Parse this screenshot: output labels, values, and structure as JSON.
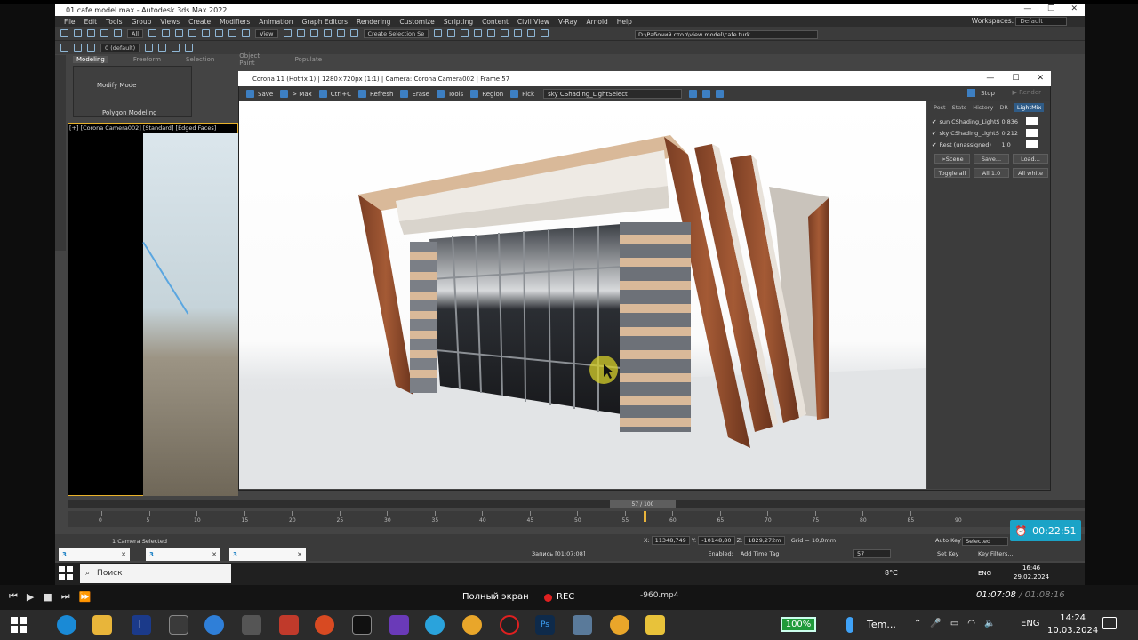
{
  "app": {
    "title": "01 cafe model.max - Autodesk 3ds Max 2022",
    "menu": [
      "File",
      "Edit",
      "Tools",
      "Group",
      "Views",
      "Create",
      "Modifiers",
      "Animation",
      "Graph Editors",
      "Rendering",
      "Customize",
      "Scripting",
      "Content",
      "Civil View",
      "V-Ray",
      "Arnold",
      "Help"
    ],
    "workspace_label": "Workspaces:",
    "workspace_value": "Default",
    "selection_filter": "All",
    "view_dropdown": "View",
    "selection_set": "Create Selection Se",
    "layer": "0 (default)",
    "path": "D:\\Рабочий стол\\view model\\cafe turk"
  },
  "ribbon": {
    "tabs": [
      "Modeling",
      "Freeform",
      "Selection",
      "Object Paint",
      "Populate"
    ],
    "modify_mode": "Modify Mode",
    "polygon_modeling": "Polygon Modeling"
  },
  "viewport": {
    "label": "[+] [Corona Camera002] [Standard] [Edged Faces]"
  },
  "corona": {
    "title": "Corona 11 (Hotfix 1) | 1280×720px (1:1) | Camera: Corona Camera002 | Frame 57",
    "toolbar": [
      "Save",
      "> Max",
      "Ctrl+C",
      "Refresh",
      "Erase",
      "Tools",
      "Region",
      "Pick"
    ],
    "lightselect": "sky CShading_LightSelect",
    "stop": "Stop",
    "render": "Render",
    "panel_tabs": [
      "Post",
      "Stats",
      "History",
      "DR",
      "LightMix"
    ],
    "lights": [
      {
        "name": "sun CShading_LightSe",
        "value": "0,836"
      },
      {
        "name": "sky CShading_LightSe",
        "value": "0,212"
      },
      {
        "name": "Rest (unassigned)",
        "value": "1,0"
      }
    ],
    "buttons_row1": [
      ">Scene",
      "Save...",
      "Load..."
    ],
    "buttons_row2": [
      "Toggle all",
      "All 1.0",
      "All white"
    ]
  },
  "timeline": {
    "slider": "57 / 100",
    "ticks": [
      "0",
      "5",
      "10",
      "15",
      "20",
      "25",
      "30",
      "35",
      "40",
      "45",
      "50",
      "55",
      "60",
      "65",
      "70",
      "75",
      "80",
      "85",
      "90"
    ],
    "status": "1 Camera Selected",
    "recording": "Запись [01:07:08]",
    "x": "11348,749",
    "y": "-10148,80",
    "z": "1829,272m",
    "grid": "Grid = 10,0mm",
    "enabled": "Enabled:",
    "add_time_tag": "Add Time Tag",
    "auto_key": "Auto Key",
    "set_key": "Set Key",
    "selected": "Selected",
    "key_filters": "Key Filters...",
    "frame": "57"
  },
  "inner_taskbar": {
    "search": "Поиск",
    "temp": "8°C",
    "lang": "ENG",
    "time": "16:46",
    "date": "29.02.2024"
  },
  "recorder_timer": "00:22:51",
  "player": {
    "fullscreen": "Полный экран",
    "rec": "REC",
    "filename": "-960.mp4",
    "time_current": "01:07:08",
    "time_total": "01:08:16"
  },
  "taskbar": {
    "battery": "100%",
    "temp_label": "Tem...",
    "lang": "ENG",
    "time": "14:24",
    "date": "10.03.2024"
  },
  "colors": {
    "accent_blue": "#3d7fc2",
    "viewport_border": "#e9b22a",
    "timer_bg": "#1ba3c7",
    "battery": "#1f9a3a",
    "rec_red": "#e02020"
  }
}
